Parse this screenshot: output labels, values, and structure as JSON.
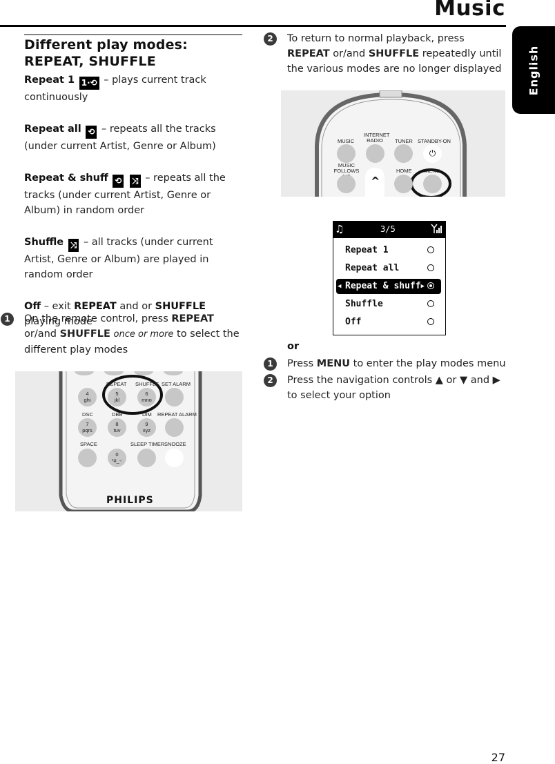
{
  "header": {
    "title": "Music",
    "language_tab": "English"
  },
  "section": {
    "title": "Different play modes: REPEAT, SHUFFLE",
    "modes": [
      {
        "name": "Repeat 1",
        "icons": [
          "repeat-one-icon"
        ],
        "description": "– plays current track continuously"
      },
      {
        "name": "Repeat all",
        "icons": [
          "repeat-all-icon"
        ],
        "description": "– repeats all the tracks (under current Artist, Genre or Album)"
      },
      {
        "name": "Repeat & shuff",
        "icons": [
          "repeat-all-icon",
          "shuffle-icon"
        ],
        "description": "– repeats all the tracks (under current Artist, Genre or Album) in random order"
      },
      {
        "name": "Shuffle",
        "icons": [
          "shuffle-icon"
        ],
        "description": "– all tracks (under current Artist, Genre or Album) are played in random order"
      },
      {
        "name": "Off",
        "icons": [],
        "description_parts": [
          "– exit ",
          "REPEAT",
          " and or ",
          "SHUFFLE",
          " playing mode"
        ]
      }
    ]
  },
  "steps_a": [
    {
      "num": "1",
      "parts": [
        "On the remote control, press ",
        "REPEAT",
        " or/and ",
        "SHUFFLE",
        " ",
        "once or more",
        " to select the different play modes"
      ]
    },
    {
      "num": "2",
      "parts": [
        "To return to normal playback, press ",
        "REPEAT",
        " or/and ",
        "SHUFFLE",
        " repeatedly until the various modes are no longer displayed"
      ]
    }
  ],
  "or_label": "or",
  "steps_b": [
    {
      "num": "1",
      "parts": [
        "Press ",
        "MENU",
        " to enter the play modes menu"
      ]
    },
    {
      "num": "2",
      "parts": [
        "Press the navigation controls ",
        "▲",
        " or ",
        "▼",
        " and ",
        "▶",
        " to select your option"
      ]
    }
  ],
  "remote_bottom": {
    "labels": [
      "REPEAT",
      "SHUFFLE",
      "SET ALARM",
      "DSC",
      "DBB",
      "DIM",
      "REPEAT ALARM",
      "SPACE",
      "SLEEP TIMER",
      "SNOOZE"
    ],
    "keys": [
      {
        "top": "4",
        "bottom": "ghi"
      },
      {
        "top": "5",
        "bottom": "jkl"
      },
      {
        "top": "6",
        "bottom": "mno"
      },
      {
        "top": "7",
        "bottom": "pqrs"
      },
      {
        "top": "8",
        "bottom": "tuv"
      },
      {
        "top": "9",
        "bottom": "xyz"
      },
      {
        "top": "0",
        "bottom": "*#_-:"
      }
    ],
    "brand": "PHILIPS"
  },
  "remote_top": {
    "labels": [
      "MUSIC",
      "INTERNET RADIO",
      "TUNER",
      "STANDBY-ON",
      "MUSIC FOLLOWS ME",
      "HOME",
      "MENU"
    ],
    "nav_up": "^",
    "power_symbol": "⏻"
  },
  "lcd": {
    "position": "3/5",
    "items": [
      {
        "label": "Repeat 1",
        "selected": false
      },
      {
        "label": "Repeat all",
        "selected": false
      },
      {
        "label": "Repeat & shuff",
        "selected": true
      },
      {
        "label": "Shuffle",
        "selected": false
      },
      {
        "label": "Off",
        "selected": false
      }
    ]
  },
  "page_number": "27"
}
